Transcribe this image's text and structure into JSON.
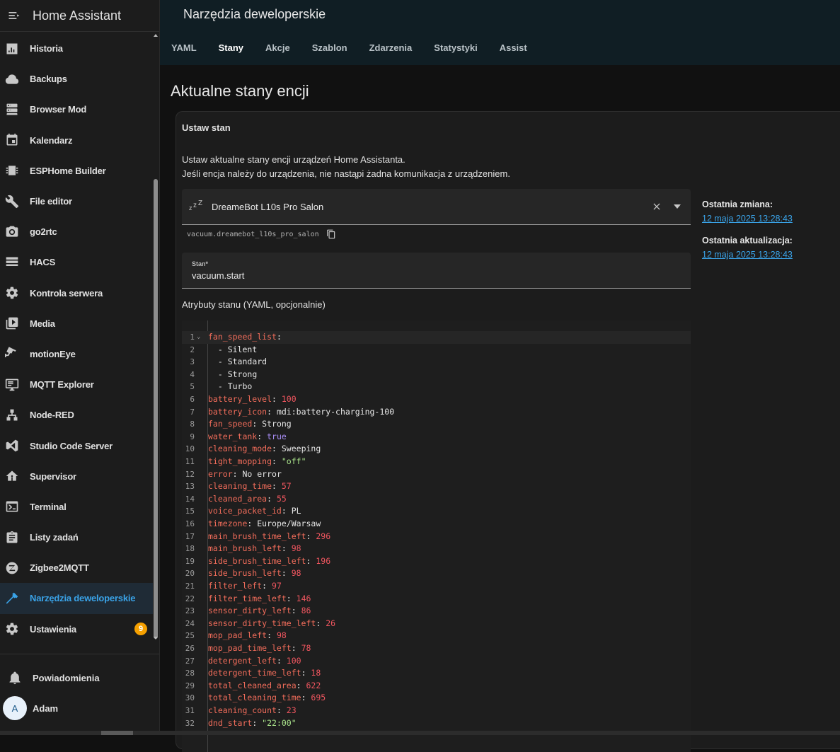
{
  "sidebar": {
    "title": "Home Assistant",
    "items": [
      {
        "label": "Historia",
        "icon": "chart-bar-icon"
      },
      {
        "label": "Backups",
        "icon": "cloud-icon"
      },
      {
        "label": "Browser Mod",
        "icon": "server-icon"
      },
      {
        "label": "Kalendarz",
        "icon": "calendar-icon"
      },
      {
        "label": "ESPHome Builder",
        "icon": "chip-icon"
      },
      {
        "label": "File editor",
        "icon": "wrench-icon"
      },
      {
        "label": "go2rtc",
        "icon": "camera-icon"
      },
      {
        "label": "HACS",
        "icon": "hacs-icon"
      },
      {
        "label": "Kontrola serwera",
        "icon": "cog-icon"
      },
      {
        "label": "Media",
        "icon": "play-box-icon"
      },
      {
        "label": "motionEye",
        "icon": "cctv-icon"
      },
      {
        "label": "MQTT Explorer",
        "icon": "monitor-icon"
      },
      {
        "label": "Node-RED",
        "icon": "sitemap-icon"
      },
      {
        "label": "Studio Code Server",
        "icon": "vscode-icon"
      },
      {
        "label": "Supervisor",
        "icon": "home-gear-icon"
      },
      {
        "label": "Terminal",
        "icon": "console-icon"
      },
      {
        "label": "Listy zadań",
        "icon": "clipboard-list-icon"
      },
      {
        "label": "Zigbee2MQTT",
        "icon": "zigbee-icon"
      },
      {
        "label": "Narzędzia deweloperskie",
        "icon": "hammer-icon",
        "active": true
      },
      {
        "label": "Ustawienia",
        "icon": "cog-icon",
        "badge": "9"
      }
    ],
    "notifications_label": "Powiadomienia",
    "user": {
      "initial": "A",
      "name": "Adam"
    }
  },
  "header": {
    "title": "Narzędzia deweloperskie",
    "tabs": [
      {
        "label": "YAML"
      },
      {
        "label": "Stany",
        "active": true
      },
      {
        "label": "Akcje"
      },
      {
        "label": "Szablon"
      },
      {
        "label": "Zdarzenia"
      },
      {
        "label": "Statystyki"
      },
      {
        "label": "Assist"
      }
    ]
  },
  "main": {
    "heading": "Aktualne stany encji",
    "card": {
      "title": "Ustaw stan",
      "description_line1": "Ustaw aktualne stany encji urządzeń Home Assistanta.",
      "description_line2": "Jeśli encja należy do urządzenia, nie nastąpi żadna komunikacja z urządzeniem.",
      "entity": {
        "icon_text": "zzz",
        "name": "DreameBot L10s Pro Salon",
        "id": "vacuum.dreamebot_l10s_pro_salon"
      },
      "state": {
        "label": "Stan*",
        "value": "vacuum.start"
      },
      "attributes_title": "Atrybuty stanu (YAML, opcjonalnie)",
      "last_changed_label": "Ostatnia zmiana:",
      "last_changed_value": "12 maja 2025 13:28:43",
      "last_updated_label": "Ostatnia aktualizacja:",
      "last_updated_value": "12 maja 2025 13:28:43"
    }
  },
  "editor": {
    "lines": [
      {
        "key": "fan_speed_list",
        "value": "",
        "type": "none"
      },
      {
        "list": "Silent"
      },
      {
        "list": "Standard"
      },
      {
        "list": "Strong"
      },
      {
        "list": "Turbo"
      },
      {
        "key": "battery_level",
        "value": "100",
        "type": "n"
      },
      {
        "key": "battery_icon",
        "value": "mdi:battery-charging-100",
        "type": "p"
      },
      {
        "key": "fan_speed",
        "value": "Strong",
        "type": "p"
      },
      {
        "key": "water_tank",
        "value": "true",
        "type": "b"
      },
      {
        "key": "cleaning_mode",
        "value": "Sweeping",
        "type": "p"
      },
      {
        "key": "tight_mopping",
        "value": "\"off\"",
        "type": "s"
      },
      {
        "key": "error",
        "value": "No error",
        "type": "p"
      },
      {
        "key": "cleaning_time",
        "value": "57",
        "type": "n"
      },
      {
        "key": "cleaned_area",
        "value": "55",
        "type": "n"
      },
      {
        "key": "voice_packet_id",
        "value": "PL",
        "type": "p"
      },
      {
        "key": "timezone",
        "value": "Europe/Warsaw",
        "type": "p"
      },
      {
        "key": "main_brush_time_left",
        "value": "296",
        "type": "n"
      },
      {
        "key": "main_brush_left",
        "value": "98",
        "type": "n"
      },
      {
        "key": "side_brush_time_left",
        "value": "196",
        "type": "n"
      },
      {
        "key": "side_brush_left",
        "value": "98",
        "type": "n"
      },
      {
        "key": "filter_left",
        "value": "97",
        "type": "n"
      },
      {
        "key": "filter_time_left",
        "value": "146",
        "type": "n"
      },
      {
        "key": "sensor_dirty_left",
        "value": "86",
        "type": "n"
      },
      {
        "key": "sensor_dirty_time_left",
        "value": "26",
        "type": "n"
      },
      {
        "key": "mop_pad_left",
        "value": "98",
        "type": "n"
      },
      {
        "key": "mop_pad_time_left",
        "value": "78",
        "type": "n"
      },
      {
        "key": "detergent_left",
        "value": "100",
        "type": "n"
      },
      {
        "key": "detergent_time_left",
        "value": "18",
        "type": "n"
      },
      {
        "key": "total_cleaned_area",
        "value": "622",
        "type": "n"
      },
      {
        "key": "total_cleaning_time",
        "value": "695",
        "type": "n"
      },
      {
        "key": "cleaning_count",
        "value": "23",
        "type": "n"
      },
      {
        "key": "dnd_start",
        "value": "\"22:00\"",
        "type": "s"
      }
    ]
  },
  "colors": {
    "accent": "#3aa3e8",
    "badge": "#f5a000",
    "key": "#f36d5b",
    "number": "#f0565f",
    "string": "#a9e28a",
    "bool": "#a98ef7"
  }
}
